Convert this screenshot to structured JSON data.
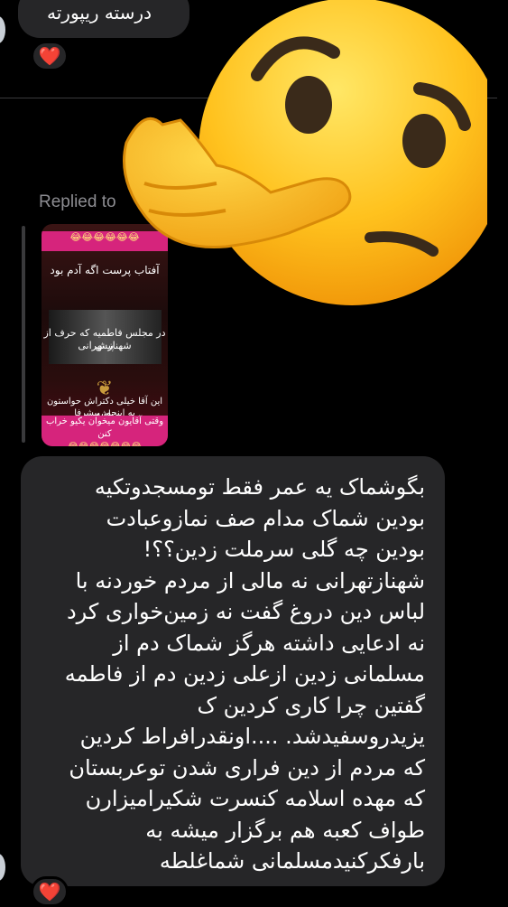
{
  "top_message": {
    "text": "درسته ریپورته",
    "reaction": "❤️"
  },
  "reply": {
    "label": "Replied to",
    "thumbnail": {
      "top_strip": "😂😂😂😂😂😂",
      "caption_top": "آفتاب پرست اگه آدم بود",
      "caption_mid_1": "در مجلس فاطمیه که حرف از پیش",
      "caption_mid_2": "شهناز تهرانی",
      "caption_low_1": "این آقا خیلی دکتراش حواستون باشه",
      "caption_low_2": "یه اینجور بیشرفا",
      "caption_bottom": "وقتی آقایون میخوان یکیو خراب کنن",
      "bottom_strip": "😂😂😂😂😂😂😂"
    }
  },
  "main_message": {
    "lines": [
      "بگوشماک یه عمر فقط تومسجدوتکیه",
      "بودین شماک مدام صف نمازوعبادت",
      "بودین چه گلی سرملت زدین؟؟!",
      "شهنازتهرانی نه مالی از مردم خوردنه با",
      "لباس دین دروغ گفت نه زمین‌خواری کرد",
      "نه ادعایی داشته هرگز شماک دم از",
      "مسلمانی زدین  ازعلی زدین دم از فاطمه",
      "گفتین چرا کاری کردین ک",
      "یزیدروسفیدشد.  ....اونقدرافراط کردین",
      "که مردم از دین فراری شدن توعربستان",
      "که  مهده اسلامه کنسرت شکیرامیزارن",
      "طواف کعبه هم برگزار میشه به",
      "بارفکرکنیدمسلمانی شماغلطه"
    ],
    "reaction": "❤️"
  },
  "overlay_emoji": "thinking-face"
}
